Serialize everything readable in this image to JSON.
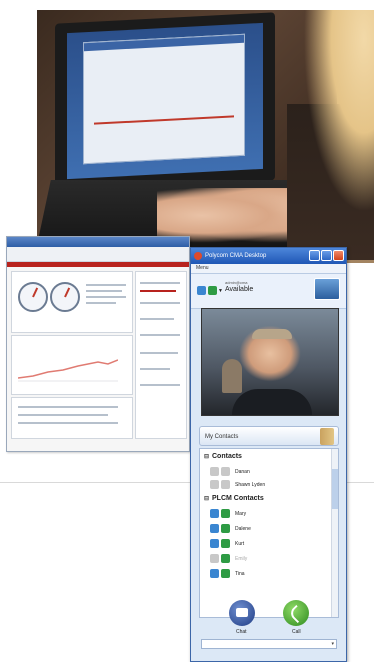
{
  "photo": {},
  "dashboard": {},
  "cma": {
    "title": "Polycom CMA Desktop",
    "menu": "Menu",
    "status": {
      "user": "admin@cma",
      "value": "Available"
    },
    "contacts_label": "My Contacts",
    "groups": [
      {
        "name": "Contacts",
        "items": [
          {
            "name": "Danan",
            "dim": false
          },
          {
            "name": "Shawn Lyden",
            "dim": false
          }
        ]
      },
      {
        "name": "PLCM Contacts",
        "items": [
          {
            "name": "Mary",
            "dim": false
          },
          {
            "name": "Dalene",
            "dim": false
          },
          {
            "name": "Kurt",
            "dim": false
          },
          {
            "name": "Emily",
            "dim": true
          },
          {
            "name": "Tina",
            "dim": false
          }
        ]
      }
    ],
    "actions": {
      "chat": "Chat",
      "call": "Call"
    }
  }
}
